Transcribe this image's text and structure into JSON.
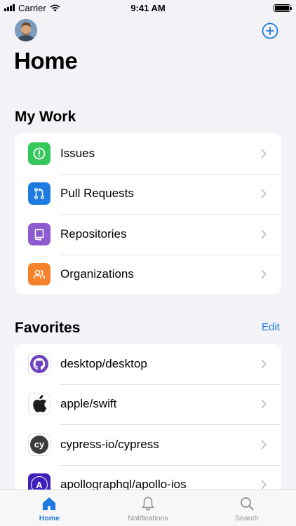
{
  "status_bar": {
    "carrier": "Carrier",
    "time": "9:41 AM"
  },
  "header": {
    "title": "Home"
  },
  "my_work": {
    "title": "My Work",
    "items": [
      {
        "label": "Issues",
        "icon": "issues-icon",
        "color": "#34C759"
      },
      {
        "label": "Pull Requests",
        "icon": "pull-request-icon",
        "color": "#1E7CE0"
      },
      {
        "label": "Repositories",
        "icon": "repository-icon",
        "color": "#8E5AD0"
      },
      {
        "label": "Organizations",
        "icon": "organizations-icon",
        "color": "#F5822A"
      }
    ]
  },
  "favorites": {
    "title": "Favorites",
    "edit_label": "Edit",
    "items": [
      {
        "label": "desktop/desktop",
        "icon": "github-desktop-icon"
      },
      {
        "label": "apple/swift",
        "icon": "apple-icon"
      },
      {
        "label": "cypress-io/cypress",
        "icon": "cypress-icon",
        "logo_text": "cy"
      },
      {
        "label": "apollographql/apollo-ios",
        "icon": "apollo-icon",
        "logo_text": "A"
      }
    ]
  },
  "tab_bar": {
    "tabs": [
      {
        "label": "Home",
        "icon": "home-icon",
        "active": true
      },
      {
        "label": "Notifications",
        "icon": "bell-icon",
        "active": false
      },
      {
        "label": "Search",
        "icon": "search-icon",
        "active": false
      }
    ]
  },
  "colors": {
    "accent": "#1E7CE0",
    "background": "#F2F2F7"
  }
}
